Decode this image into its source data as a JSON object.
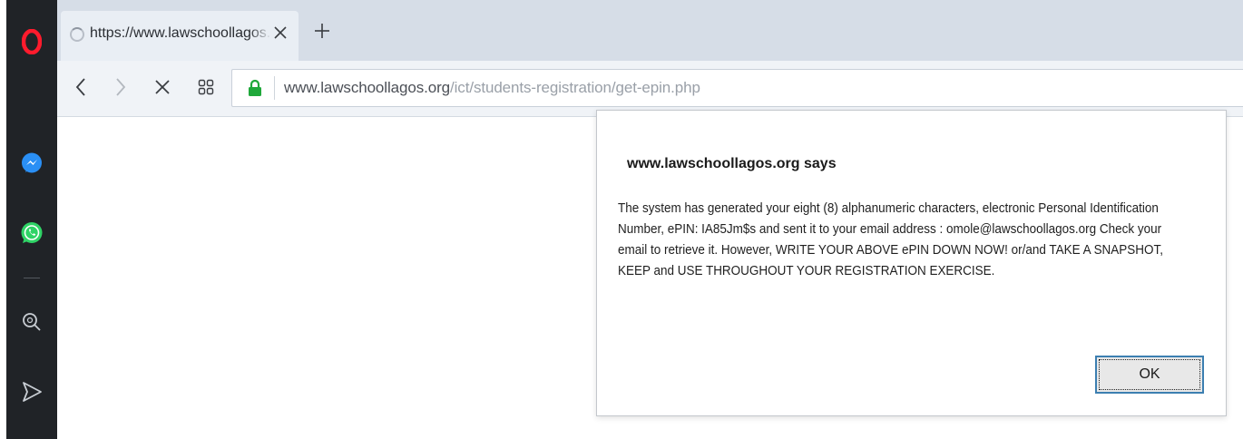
{
  "browser": {
    "tab": {
      "title": "https://www.lawschoollagos.org/ict/students-registration/get-epin.php",
      "close_icon": "close-icon",
      "loading_icon": "loading-spinner-icon"
    },
    "new_tab_icon": "plus-icon",
    "nav": {
      "back_icon": "chevron-left-icon",
      "forward_icon": "chevron-right-icon",
      "stop_icon": "close-icon",
      "speed_dial_icon": "grid-icon"
    },
    "address": {
      "lock_icon": "lock-icon",
      "host": "www.lawschoollagos.org",
      "path": "/ict/students-registration/get-epin.php"
    }
  },
  "sidebar": {
    "items": [
      {
        "name": "opera-logo-icon",
        "color": "#ff1b2d"
      },
      {
        "name": "messenger-icon",
        "color": "#2a8ff5"
      },
      {
        "name": "whatsapp-icon",
        "color": "#2fd366"
      },
      {
        "name": "search-icon"
      },
      {
        "name": "flow-send-icon"
      }
    ]
  },
  "dialog": {
    "title": "www.lawschoollagos.org says",
    "message": "The system has generated your eight (8) alphanumeric characters, electronic Personal Identification Number, ePIN: IA85Jm$s and sent it to your email address : omole@lawschoollagos.org Check your email to retrieve it. However, WRITE YOUR ABOVE ePIN DOWN NOW! or/and TAKE A SNAPSHOT, KEEP and USE THROUGHOUT YOUR REGISTRATION EXERCISE.",
    "ok_label": "OK"
  },
  "colors": {
    "sidebar_bg": "#202327",
    "tabstrip_bg": "#d6dde7",
    "lock_green": "#1fa83a",
    "button_focus": "#3c7fb1"
  }
}
